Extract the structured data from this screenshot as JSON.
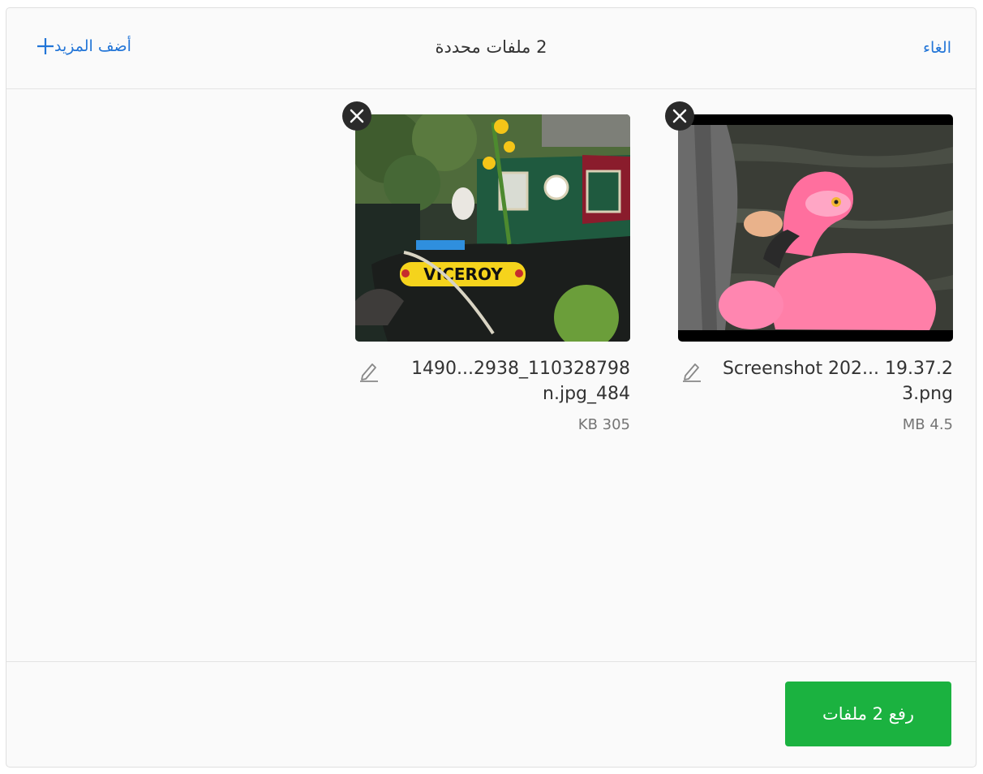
{
  "header": {
    "cancel_label": "الغاء",
    "title": "2 ملفات محددة",
    "add_more_label": "أضف المزيد"
  },
  "files": [
    {
      "name": "Screenshot 202... 19.37.23.png",
      "size": "MB 4.5",
      "thumb_description": "pink-flamingo-float"
    },
    {
      "name": "1490...2938_110328798n.jpg_484",
      "size": "KB 305",
      "thumb_description": "canal-boat-viceroy",
      "boat_label": "VICEROY"
    }
  ],
  "footer": {
    "upload_label": "رفع 2 ملفات"
  },
  "colors": {
    "accent": "#2275d7",
    "upload_green": "#1bb240",
    "remove_bg": "#2a2a2a"
  },
  "icons": {
    "add": "plus-icon",
    "remove": "close-icon",
    "edit": "pencil-icon"
  }
}
